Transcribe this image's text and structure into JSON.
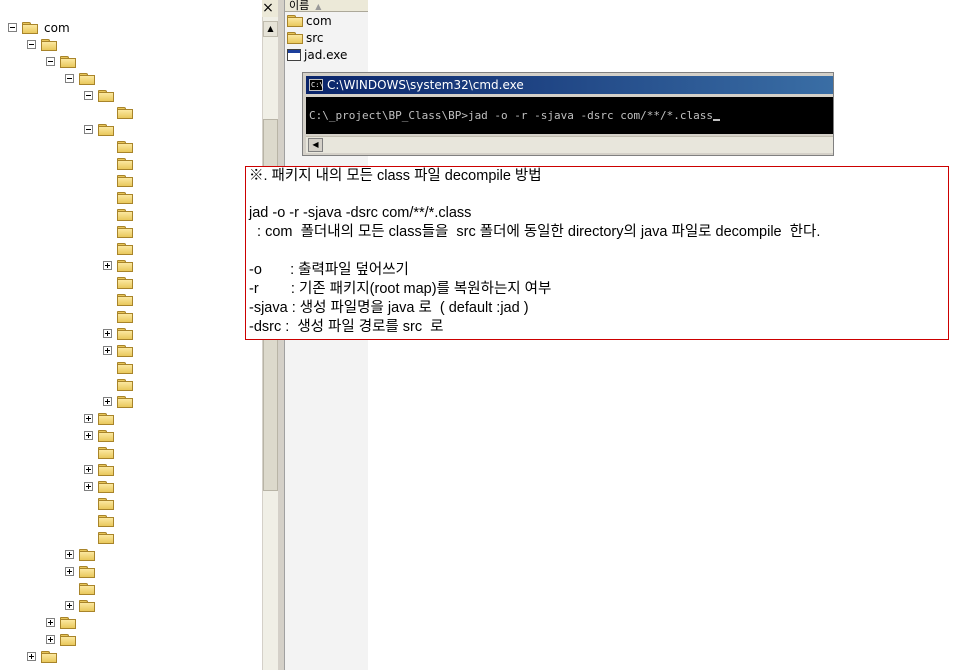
{
  "tree": {
    "close_glyph": "×",
    "root_label": "com",
    "scroll_up_glyph": "▲"
  },
  "file_list": {
    "header_label": "이름",
    "header_sort_glyph": "▲",
    "items": [
      {
        "label": "com",
        "icon": "folder-icon"
      },
      {
        "label": "src",
        "icon": "folder-icon"
      },
      {
        "label": "jad.exe",
        "icon": "exe-icon"
      }
    ]
  },
  "cmd": {
    "icon_text": "C:\\",
    "title": "C:\\WINDOWS\\system32\\cmd.exe",
    "command_line": "C:\\_project\\BP_Class\\BP>jad -o -r -sjava -dsrc com/**/*.class",
    "scroll_left_glyph": "◀"
  },
  "note": {
    "lines": [
      "※. 패키지 내의 모든 class 파일 decompile 방법",
      "",
      "jad -o -r -sjava -dsrc com/**/*.class",
      "  : com  폴더내의 모든 class들을  src 폴더에 동일한 directory의 java 파일로 decompile  한다.",
      "",
      "-o       : 출력파일 덮어쓰기",
      "-r        : 기존 패키지(root map)를 복원하는지 여부",
      "-sjava : 생성 파일명을 java 로  ( default :jad )",
      "-dsrc :  생성 파일 경로를 src  로"
    ]
  },
  "colors": {
    "note_border": "#cc0000",
    "cmd_title_bg": "#0a246a",
    "folder_fill": "#e9c85c"
  }
}
